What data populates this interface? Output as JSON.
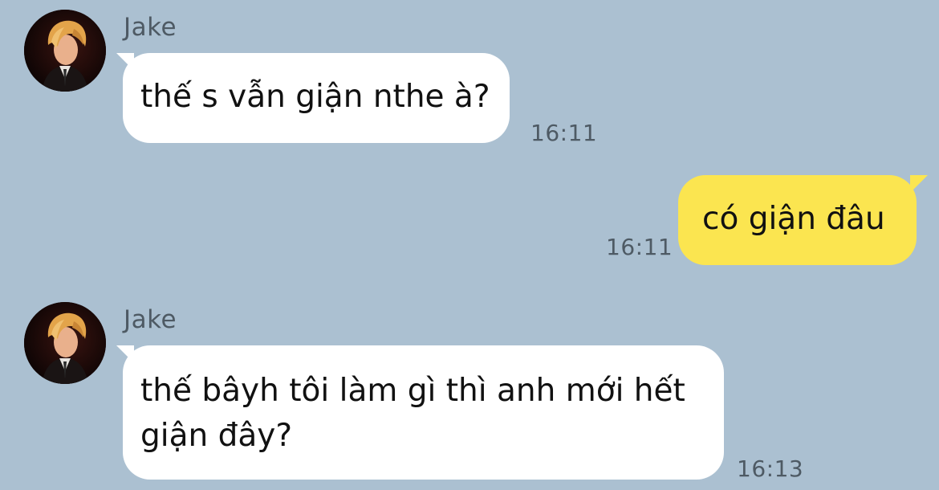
{
  "messages": [
    {
      "direction": "incoming",
      "sender": "Jake",
      "avatar_icon": "profile-photo",
      "lines": [
        "thế s vẫn giận nthe à?"
      ],
      "time": "16:11"
    },
    {
      "direction": "outgoing",
      "lines": [
        "có giận đâu"
      ],
      "time": "16:11"
    },
    {
      "direction": "incoming",
      "sender": "Jake",
      "avatar_icon": "profile-photo",
      "lines": [
        "thế bâyh tôi làm gì thì anh mới hết",
        "giận đây?"
      ],
      "time": "16:13"
    }
  ],
  "colors": {
    "background": "#abc0d1",
    "incoming_bubble": "#ffffff",
    "outgoing_bubble": "#fbe550",
    "meta_text": "#4e5a64"
  }
}
